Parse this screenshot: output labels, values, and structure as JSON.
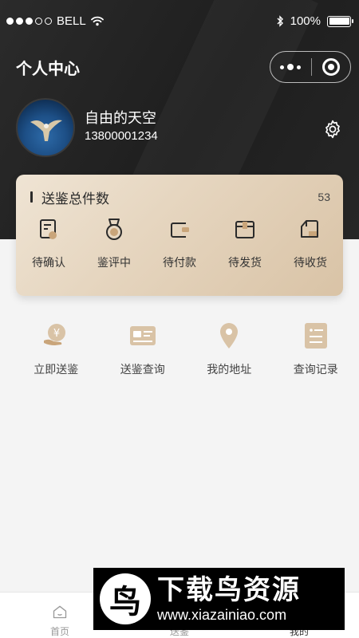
{
  "status_bar": {
    "carrier": "BELL",
    "battery": "100%"
  },
  "header": {
    "title": "个人中心"
  },
  "user": {
    "name": "自由的天空",
    "phone": "13800001234"
  },
  "summary": {
    "title": "送鉴总件数",
    "count": "53",
    "orders": [
      {
        "label": "待确认",
        "icon": "document-clock-icon"
      },
      {
        "label": "鉴评中",
        "icon": "medal-icon"
      },
      {
        "label": "待付款",
        "icon": "wallet-icon"
      },
      {
        "label": "待发货",
        "icon": "box-icon"
      },
      {
        "label": "待收货",
        "icon": "truck-icon"
      }
    ]
  },
  "tools": [
    {
      "label": "立即送鉴",
      "icon": "yen-hand-icon"
    },
    {
      "label": "送鉴查询",
      "icon": "id-card-icon"
    },
    {
      "label": "我的地址",
      "icon": "location-pin-icon"
    },
    {
      "label": "查询记录",
      "icon": "record-list-icon"
    }
  ],
  "tabbar": [
    {
      "label": "首页",
      "icon": "home-icon"
    },
    {
      "label": "送鉴",
      "icon": "send-icon"
    },
    {
      "label": "我的",
      "icon": "profile-icon"
    }
  ],
  "watermark": {
    "title": "下载鸟资源",
    "url": "www.xiazainiao.com",
    "logo_char": "鸟"
  },
  "colors": {
    "hero": "#222222",
    "gold_accent": "#c9a57a",
    "card_light": "#efe4d4",
    "card_dark": "#d9c3a6"
  }
}
